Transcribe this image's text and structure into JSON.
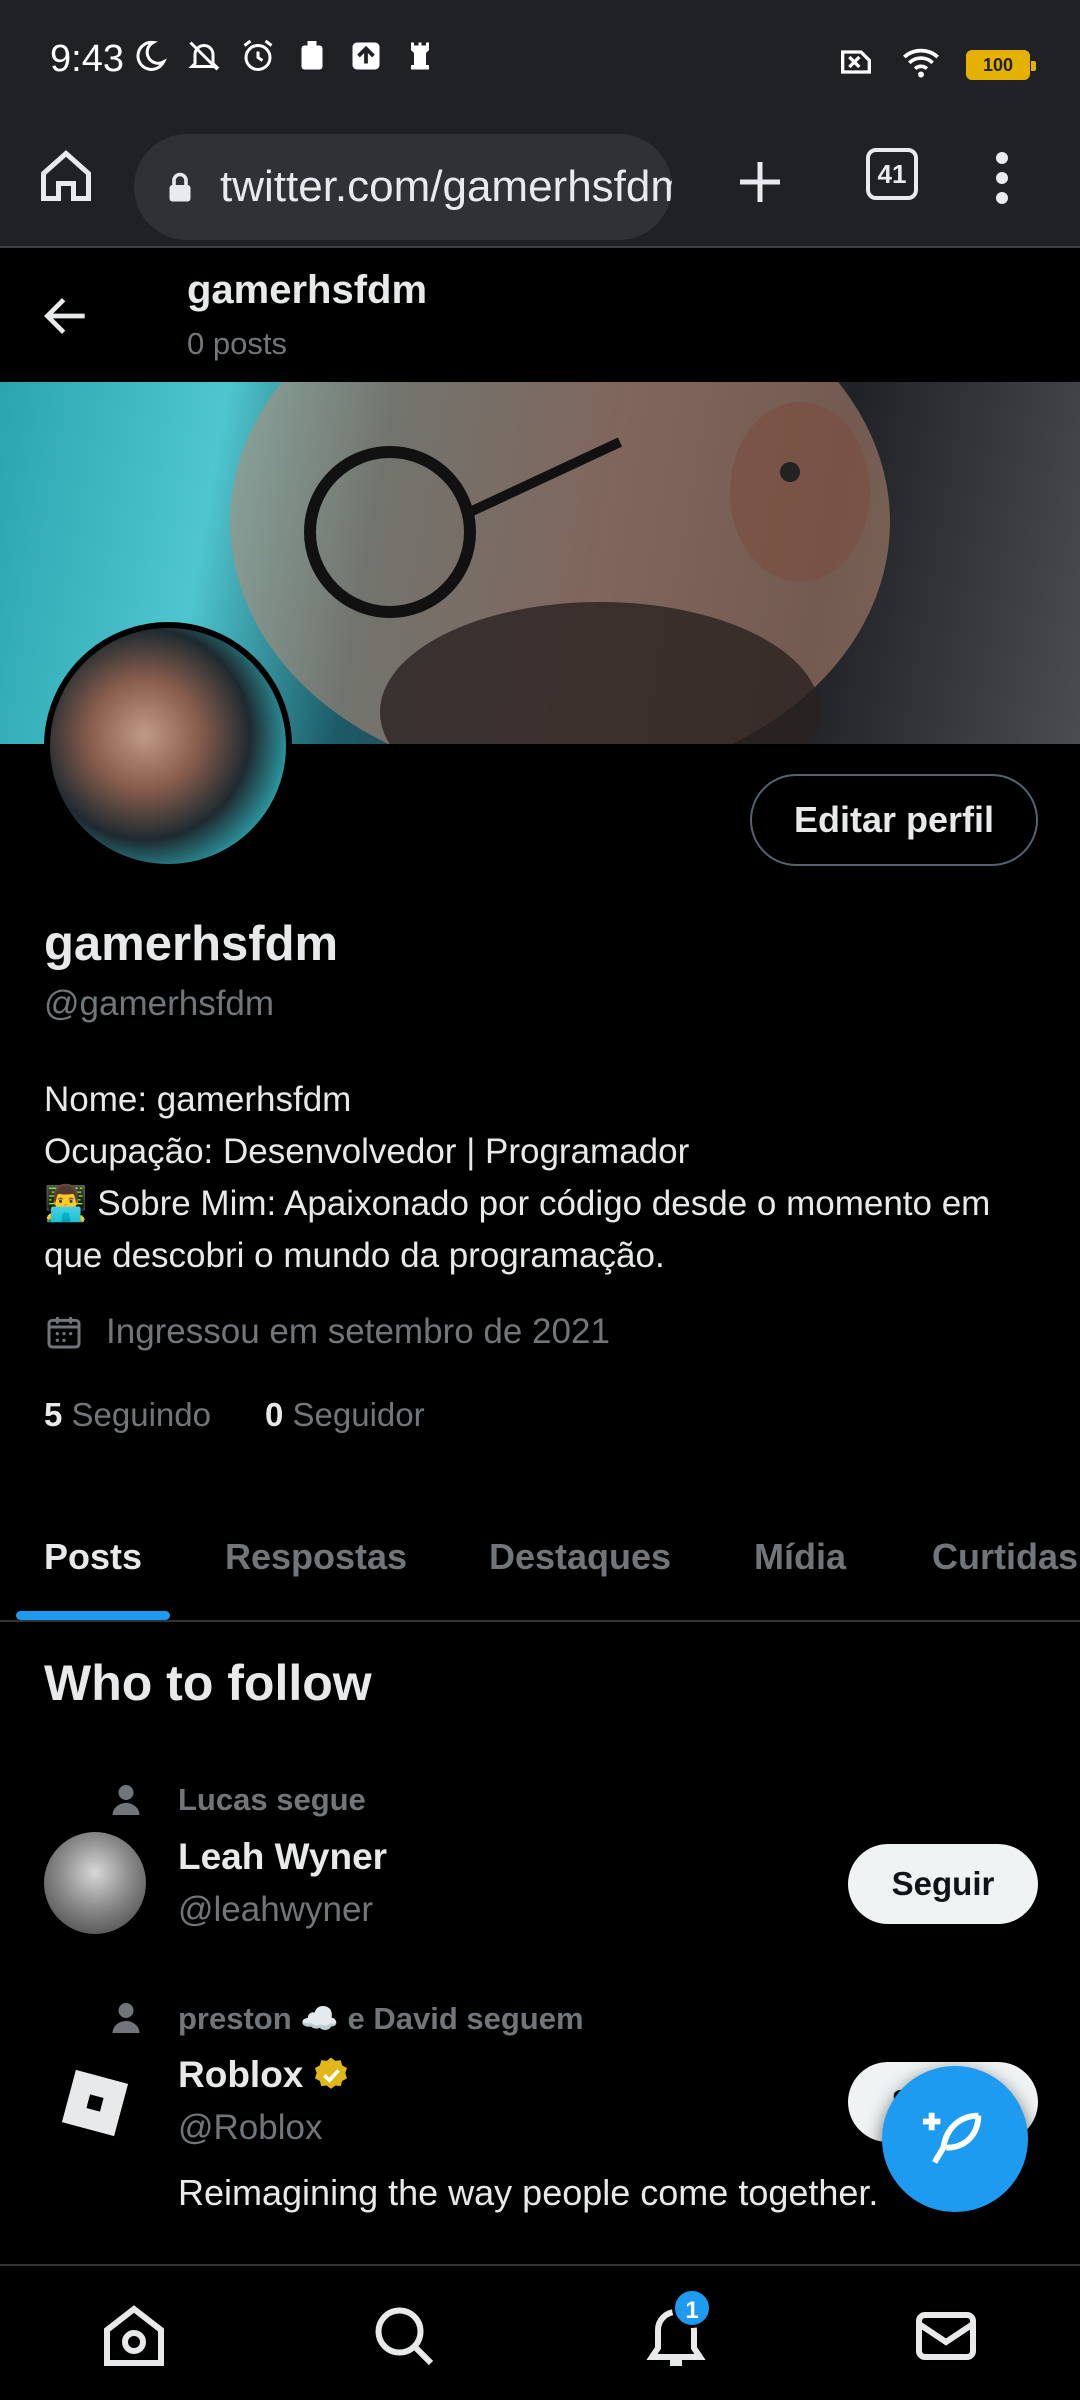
{
  "status_bar": {
    "time": "9:43",
    "battery": "100"
  },
  "browser": {
    "url": "twitter.com/gamerhsfdm",
    "tab_count": "41"
  },
  "header": {
    "name": "gamerhsfdm",
    "posts": "0 posts"
  },
  "profile": {
    "display_name": "gamerhsfdm",
    "handle": "@gamerhsfdm",
    "edit_label": "Editar perfil",
    "bio_line1": "Nome: gamerhsfdm",
    "bio_line2": "Ocupação: Desenvolvedor | Programador",
    "bio_line3": "👨‍💻 Sobre Mim: Apaixonado por código desde o momento em que descobri o mundo da programação.",
    "joined": "Ingressou em setembro de 2021",
    "following_count": "5",
    "following_label": "Seguindo",
    "followers_count": "0",
    "followers_label": "Seguidor"
  },
  "tabs": [
    "Posts",
    "Respostas",
    "Destaques",
    "Mídia",
    "Curtidas"
  ],
  "who_to_follow": {
    "title": "Who to follow",
    "items": [
      {
        "context": "Lucas segue",
        "name": "Leah Wyner",
        "handle": "@leahwyner",
        "button": "Seguir",
        "desc": ""
      },
      {
        "context": "preston ☁️ e David seguem",
        "name": "Roblox",
        "handle": "@Roblox",
        "button": "Seguir",
        "desc": "Reimagining the way people come together."
      }
    ]
  },
  "notifications_badge": "1",
  "colors": {
    "accent": "#1d9bf0",
    "background": "#000000",
    "muted": "#71767b",
    "verified": "#e2b719"
  },
  "icons": [
    "home-icon",
    "lock-icon",
    "plus-icon",
    "tabs-icon",
    "more-vert-icon",
    "back-arrow-icon",
    "calendar-icon",
    "person-icon",
    "verified-badge-icon",
    "compose-icon",
    "search-icon",
    "bell-icon",
    "mail-icon"
  ]
}
